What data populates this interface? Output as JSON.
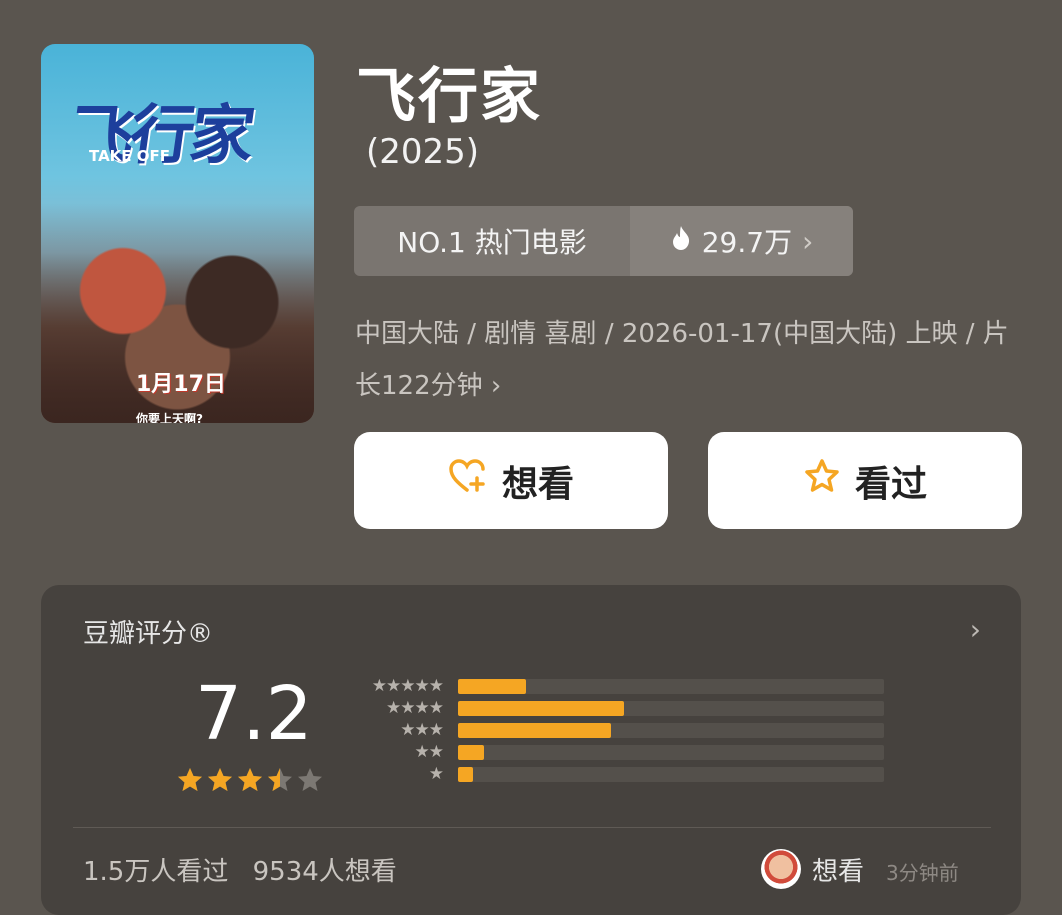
{
  "poster": {
    "title_art": "飞行家",
    "subtitle": "TAKE OFF",
    "date": "1月17日",
    "tagline": "你要上天啊?"
  },
  "movie": {
    "title": "飞行家",
    "year": "(2025)"
  },
  "rank": {
    "label": "NO.1 热门电影",
    "heat": "29.7万",
    "heat_icon": "flame-icon"
  },
  "meta_text": "中国大陆 / 剧情 喜剧 / 2026-01-17(中国大陆) 上映 / 片长122分钟",
  "actions": {
    "want_label": "想看",
    "seen_label": "看过"
  },
  "rating": {
    "title": "豆瓣评分®",
    "score": "7.2",
    "stars_value": 3.5,
    "distribution": [
      {
        "stars": "★★★★★",
        "fraction": 0.16
      },
      {
        "stars": "★★★★",
        "fraction": 0.39
      },
      {
        "stars": "★★★",
        "fraction": 0.36
      },
      {
        "stars": "★★",
        "fraction": 0.06
      },
      {
        "stars": "★",
        "fraction": 0.035
      }
    ],
    "watched": "1.5万人看过",
    "want": "9534人想看",
    "friend_status": "想看",
    "friend_time": "3分钟前"
  },
  "colors": {
    "accent": "#f5a623",
    "background": "#5a554f",
    "card": "#46423e"
  }
}
